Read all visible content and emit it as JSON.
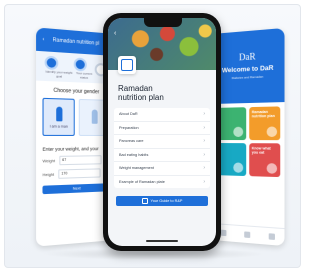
{
  "left_phone": {
    "header_title": "Ramadan nutrition pl",
    "steps": [
      "Identify your weight goal",
      "Your current status",
      ""
    ],
    "gender_title": "Choose your gender",
    "gender_options": [
      "I am a man",
      ""
    ],
    "weight_title": "Enter your weight, and your",
    "fields": [
      {
        "label": "Weight",
        "value": "67",
        "unit": "kg"
      },
      {
        "label": "Height",
        "value": "170",
        "unit": "cm"
      }
    ],
    "next_label": "Next"
  },
  "center_phone": {
    "title_line1": "Ramadan",
    "title_line2": "nutrition plan",
    "menu_items": [
      "About DaR",
      "Preparation",
      "Pancreas care",
      "Bad eating habits",
      "Weight management",
      "Example of Ramadan plate"
    ],
    "cta_label": "Your Guide to R&P"
  },
  "right_phone": {
    "logo": "DaR",
    "welcome": "Welcome to DaR",
    "subtitle": "Diabetes and Ramadan",
    "cards": [
      {
        "label": "",
        "color": "#3cb371"
      },
      {
        "label": "Ramadan nutrition plan",
        "color": "#f39c2a"
      },
      {
        "label": "",
        "color": "#18a9c4"
      },
      {
        "label": "Know what you eat",
        "color": "#e04e4e"
      }
    ]
  },
  "colors": {
    "primary": "#1e6fd9"
  }
}
